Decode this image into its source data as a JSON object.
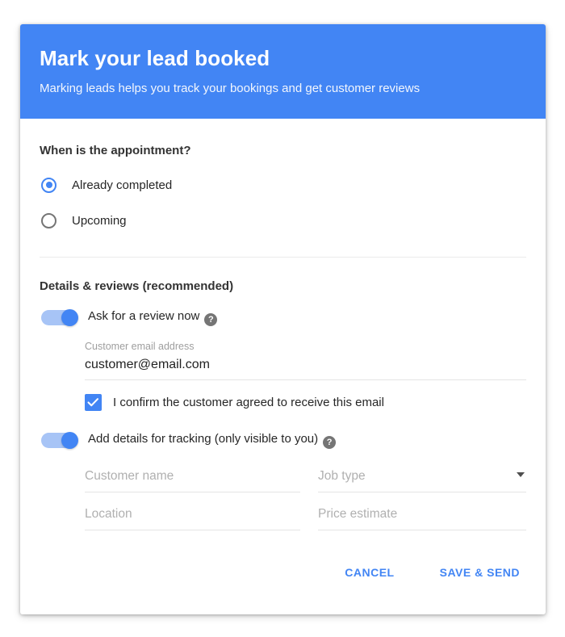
{
  "colors": {
    "accent": "#4285f4",
    "toggle_track": "#a7c4f6",
    "help_icon": "#757575",
    "divider": "#ebebeb",
    "field_underline": "#e4e4e4",
    "placeholder": "#b0b0b0"
  },
  "header": {
    "title": "Mark your lead booked",
    "subtitle": "Marking leads helps you track your bookings and get customer reviews"
  },
  "appointment_section": {
    "heading": "When is the appointment?",
    "options": [
      {
        "label": "Already completed",
        "selected": true
      },
      {
        "label": "Upcoming",
        "selected": false
      }
    ]
  },
  "details_section": {
    "heading": "Details & reviews (recommended)",
    "review_toggle": {
      "label": "Ask for a review now",
      "state": "on",
      "help_icon": "help-circle-icon",
      "help_glyph": "?"
    },
    "email_field": {
      "caption": "Customer email address",
      "value": "customer@email.com"
    },
    "confirm_checkbox": {
      "label": "I confirm the customer agreed to receive this email",
      "checked": true
    },
    "tracking_toggle": {
      "label": "Add details for tracking (only visible to you)",
      "state": "on",
      "help_icon": "help-circle-icon",
      "help_glyph": "?"
    },
    "tracking_fields": {
      "customer_name": {
        "placeholder": "Customer name",
        "value": ""
      },
      "job_type": {
        "placeholder": "Job type",
        "value": "",
        "icon": "chevron-down-icon"
      },
      "location": {
        "placeholder": "Location",
        "value": ""
      },
      "price_estimate": {
        "placeholder": "Price estimate",
        "value": ""
      }
    }
  },
  "actions": {
    "cancel_label": "CANCEL",
    "save_label": "SAVE & SEND"
  }
}
